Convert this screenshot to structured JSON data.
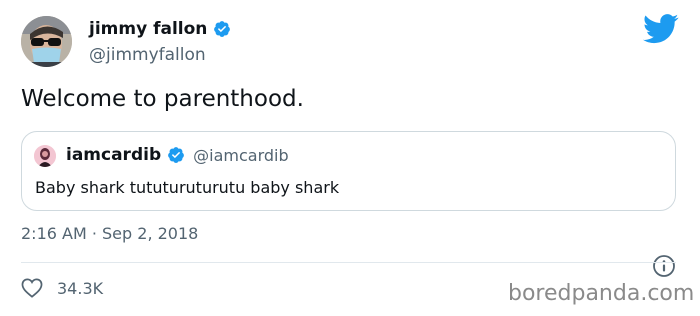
{
  "author": {
    "name": "jimmy fallon",
    "handle": "@jimmyfallon",
    "verified": true,
    "avatar_icon": "avatar-person-sunglasses-mask"
  },
  "tweet": {
    "text": "Welcome to parenthood."
  },
  "quoted_tweet": {
    "name": "iamcardib",
    "handle": "@iamcardib",
    "verified": true,
    "text": "Baby shark tututuruturutu baby shark"
  },
  "meta": {
    "timestamp": "2:16 AM · Sep 2, 2018"
  },
  "actions": {
    "like_count": "34.3K"
  },
  "watermark": "boredpanda.com",
  "colors": {
    "twitter_blue": "#1d9bf0",
    "text": "#0f1419",
    "muted": "#536471",
    "border": "#cfd9de"
  }
}
